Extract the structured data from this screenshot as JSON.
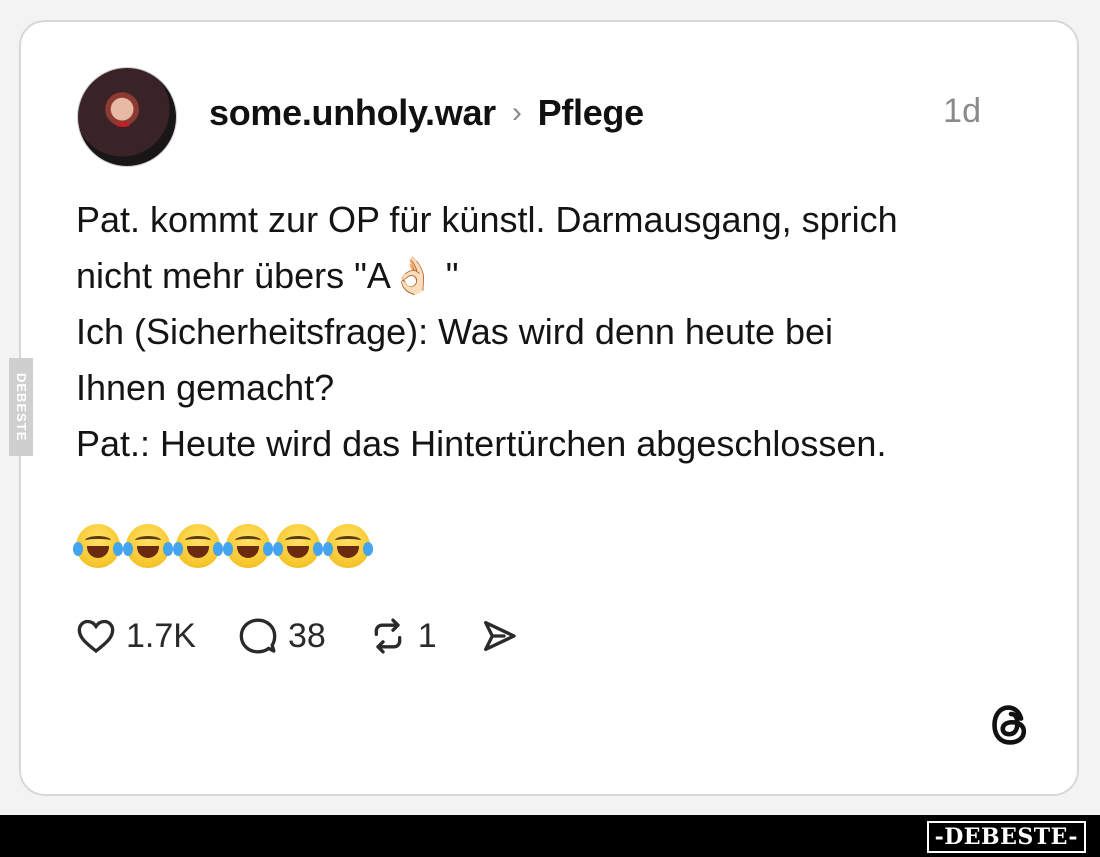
{
  "post": {
    "username": "some.unholy.war",
    "breadcrumb_separator": "›",
    "topic": "Pflege",
    "time_ago": "1d",
    "text": "Pat. kommt zur OP für künstl. Darmausgang, sprich\nnicht mehr übers \"A👌🏻 \"\nIch (Sicherheitsfrage): Was wird denn heute bei\nIhnen gemacht?\nPat.: Heute wird das Hintertürchen abgeschlossen.",
    "emojis": [
      "😂",
      "😂",
      "😂",
      "😂",
      "😂",
      "😂"
    ]
  },
  "actions": {
    "likes": "1.7K",
    "comments": "38",
    "reposts": "1"
  },
  "icons": {
    "like": "heart-icon",
    "comment": "comment-bubble-icon",
    "repost": "repost-icon",
    "share": "send-icon",
    "brand": "threads-logo-icon"
  },
  "watermarks": {
    "side": "DEBESTE",
    "bottom": "-DEBESTE-"
  },
  "colors": {
    "card_background": "#ffffff",
    "page_background": "#f3f3f3",
    "muted_text": "#8a8a8a"
  }
}
